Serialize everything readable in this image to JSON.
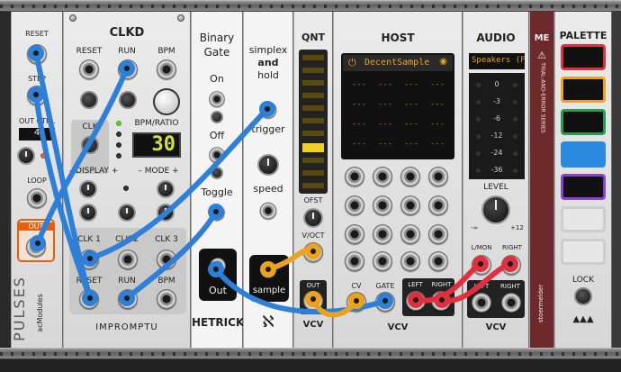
{
  "pulses": {
    "brand": "PULSES",
    "maker": "acModules",
    "labels": {
      "reset": "RESET",
      "step": "STEP",
      "out_ctrl": "OUT CTRL",
      "display": "4",
      "loop": "LOOP",
      "out": "OUT"
    }
  },
  "clkd": {
    "title": "CLKD",
    "reset": "RESET",
    "run": "RUN",
    "bpm": "BPM",
    "clk": "CLK",
    "bpm_ratio": "BPM/RATIO",
    "bpm_value": "30",
    "display": "– DISPLAY +",
    "mode": "– MODE +",
    "clk1": "CLK 1",
    "clk2": "CLK 2",
    "clk3": "CLK 3",
    "reset2": "RESET",
    "run2": "RUN",
    "bpm2": "BPM",
    "brand": "IMPROMPTU"
  },
  "binary_gate": {
    "title_line1": "Binary",
    "title_line2": "Gate",
    "on": "On",
    "off": "Off",
    "toggle": "Toggle",
    "out": "Out",
    "brand": "HETRICK"
  },
  "snh": {
    "title_line1": "simplex",
    "title_line2": "and",
    "title_line3": "hold",
    "trigger": "trigger",
    "speed": "speed",
    "sample": "sample",
    "brand": "ℵ"
  },
  "qnt": {
    "title": "QNT",
    "ofst": "OFST",
    "voct": "V/OCT",
    "out": "OUT",
    "brand": "VCV"
  },
  "host": {
    "title": "HOST",
    "plugin": "DecentSample",
    "cv": "CV",
    "gate": "GATE",
    "left": "LEFT",
    "right": "RIGHT",
    "brand": "VCV",
    "grid_cell": "---"
  },
  "audio": {
    "title": "AUDIO",
    "device": "Speakers (Fi",
    "db": [
      "0",
      "-3",
      "-6",
      "-12",
      "-24",
      "-36"
    ],
    "level": "LEVEL",
    "level_min": "-∞",
    "level_max": "+12",
    "lmon": "L/MON",
    "right": "RIGHT",
    "left": "LEFT",
    "right2": "RIGHT",
    "brand": "VCV"
  },
  "me": {
    "title": "ME",
    "subtitle": "TRIAL-AND-ERROR SERIES",
    "brand": "stoermelder"
  },
  "palette": {
    "title": "PALETTE",
    "lock": "LOCK",
    "colors": [
      "#e0303c",
      "#f0a020",
      "#20a050",
      "#2a8ae0",
      "#8a40d0"
    ]
  },
  "cable_colors": {
    "blue": "#2f7fd6",
    "yellow": "#e8a41c",
    "red": "#e03040"
  }
}
